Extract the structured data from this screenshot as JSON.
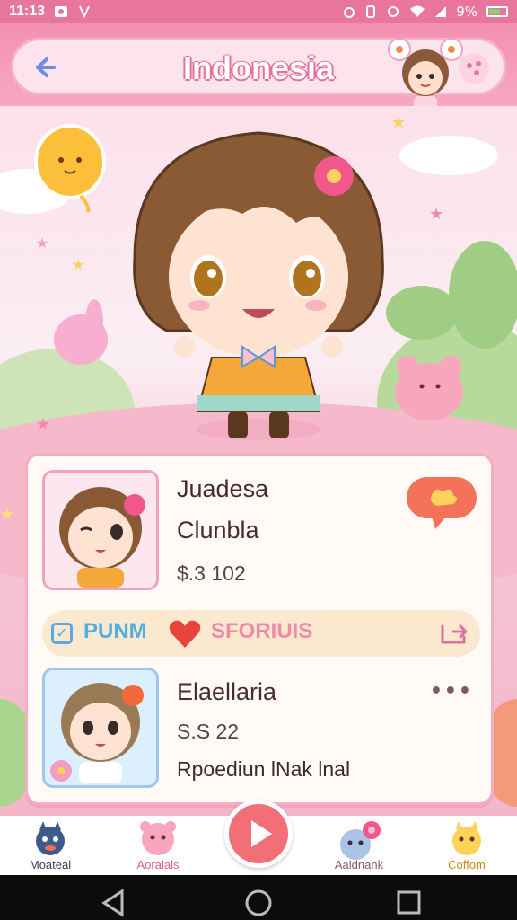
{
  "status_bar": {
    "time": "11:13",
    "battery": "9%"
  },
  "header": {
    "title": "Indonesia",
    "back_icon": "back-arrow-icon",
    "menu_icon": "dots-menu-icon"
  },
  "colors": {
    "accent": "#e8759a",
    "card_border": "#f3aec6",
    "bar_bg": "#fbe9cf",
    "blue_text": "#52aee2",
    "pink_text": "#f08aa8",
    "play": "#f36f78"
  },
  "card": {
    "item1": {
      "name": "Juadesa",
      "subname": "Clunbla",
      "price": "$.3 102"
    },
    "action_bar": {
      "left_label": "PUNM",
      "right_label": "SFORIUIS"
    },
    "item2": {
      "name": "Elaellaria",
      "price": "S.S 22",
      "subtitle": "Rpoediun lNak lnal"
    }
  },
  "bottom_nav": {
    "items": [
      {
        "label": "Moateal",
        "color": "#3f3a55"
      },
      {
        "label": "Aoralals",
        "color": "#e0607f"
      },
      {
        "label": "Aaldnank",
        "color": "#8a5a5a"
      },
      {
        "label": "Coffom",
        "color": "#c98a10"
      }
    ]
  }
}
